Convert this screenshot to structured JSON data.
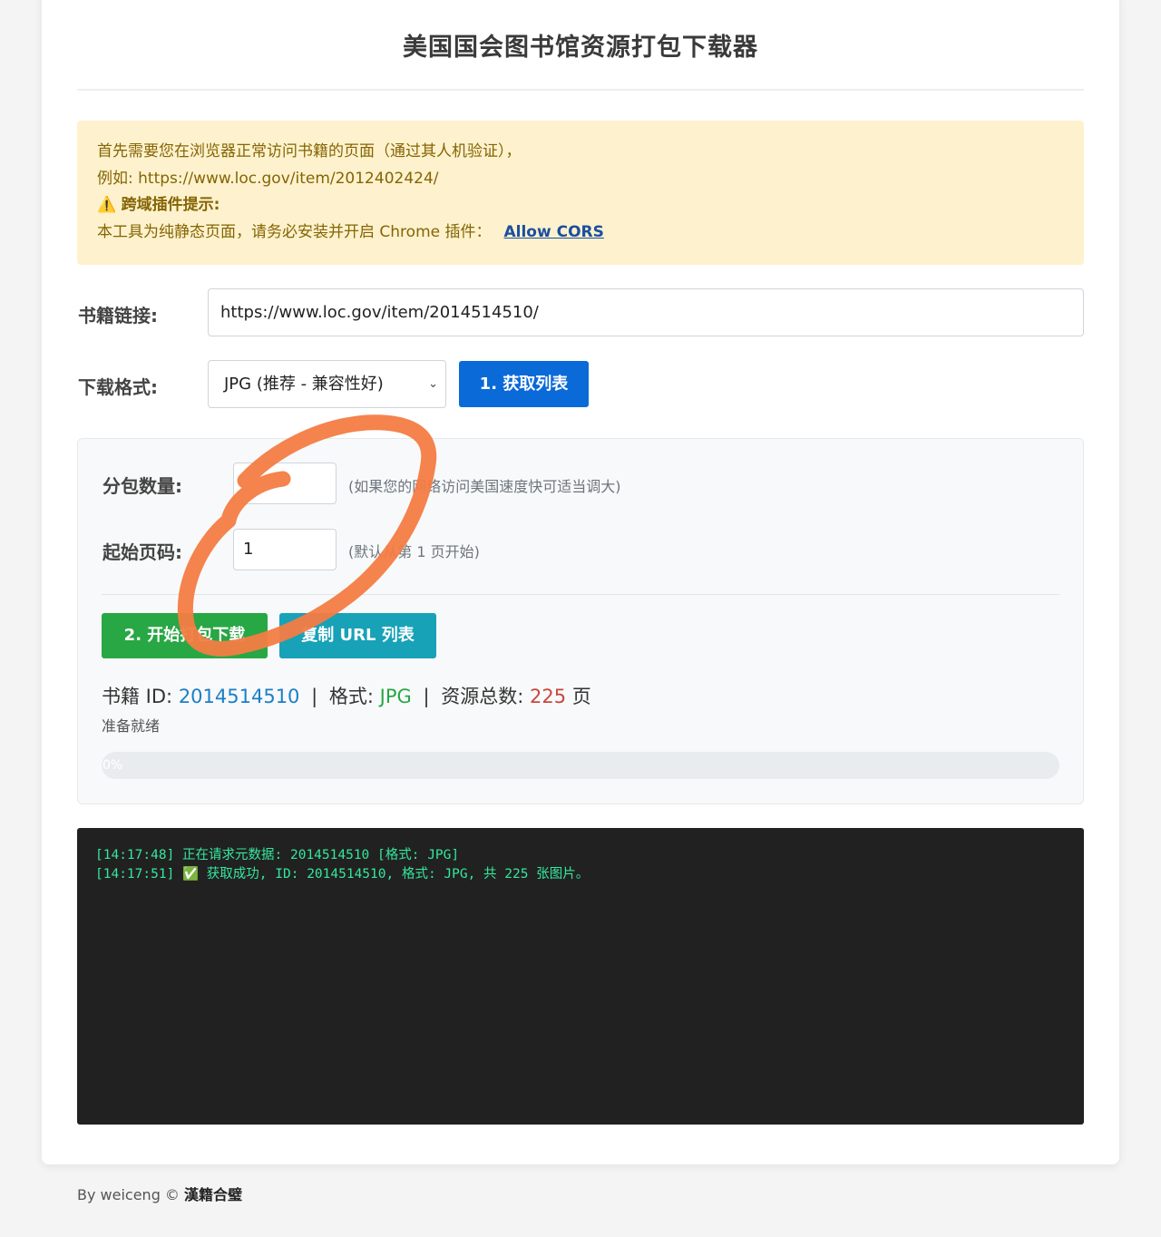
{
  "header": {
    "title": "美国国会图书馆资源打包下载器"
  },
  "notice": {
    "line1": "首先需要您在浏览器正常访问书籍的页面（通过其人机验证），",
    "line2": "例如: https://www.loc.gov/item/2012402424/",
    "warn_icon": "⚠️",
    "warn_title": "跨域插件提示:",
    "line4": "本工具为纯静态页面，请务必安装并开启 Chrome 插件：",
    "link_text": "Allow CORS"
  },
  "form": {
    "url_label": "书籍链接:",
    "url_value": "https://www.loc.gov/item/2014514510/",
    "format_label": "下载格式:",
    "format_value": "JPG (推荐 - 兼容性好)",
    "fetch_button": "1. 获取列表"
  },
  "panel": {
    "chunk_label": "分包数量:",
    "chunk_value": "",
    "chunk_hint": "(如果您的网络访问美国速度快可适当调大)",
    "start_label": "起始页码:",
    "start_value": "1",
    "start_hint": "(默认从第 1 页开始)",
    "start_button": "2. 开始打包下载",
    "copy_button": "复制 URL 列表",
    "info_id_label": "书籍 ID:",
    "info_id_value": "2014514510",
    "info_sep": "|",
    "info_format_label": "格式:",
    "info_format_value": "JPG",
    "info_total_label": "资源总数:",
    "info_total_value": "225",
    "info_total_unit": "页",
    "status": "准备就绪",
    "progress_text": "0%",
    "progress_value": 0
  },
  "log": {
    "lines": [
      "[14:17:48] 正在请求元数据: 2014514510 [格式: JPG]",
      "[14:17:51] ✅ 获取成功, ID: 2014514510, 格式: JPG, 共 225 张图片。"
    ]
  },
  "footer": {
    "by": "By weiceng ©",
    "brand": "漢籍合璧"
  },
  "colors": {
    "primary": "#0a6ad8",
    "success": "#28a745",
    "info": "#17a2b8",
    "warning_bg": "#fdf2cd",
    "log_bg": "#212121",
    "log_text": "#34e89e",
    "annotation": "#f47c43"
  }
}
